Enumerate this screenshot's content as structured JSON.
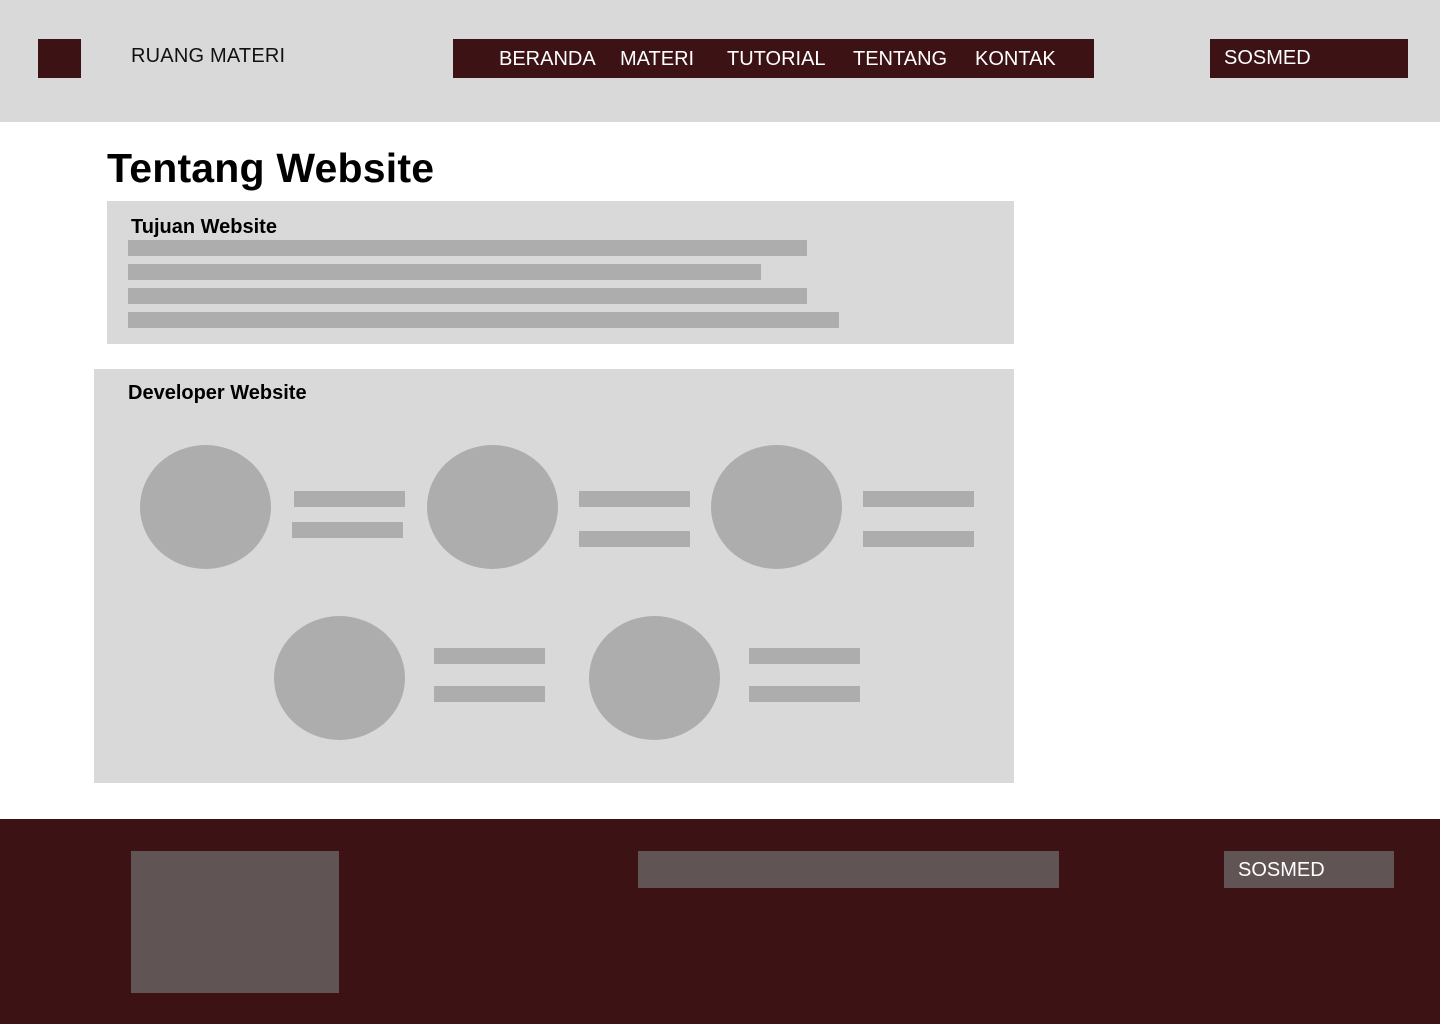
{
  "header": {
    "site_name": "RUANG MATERI",
    "nav": [
      "BERANDA",
      "MATERI",
      "TUTORIAL",
      "TENTANG",
      "KONTAK"
    ],
    "sosmed_label": "SOSMED"
  },
  "main": {
    "title": "Tentang Website",
    "tujuan_title": "Tujuan Website",
    "developer_title": "Developer Website"
  },
  "footer": {
    "sosmed_label": "SOSMED"
  },
  "colors": {
    "primary": "#3d1214",
    "header_bg": "#d9d9d9",
    "placeholder": "#adadad",
    "footer_block": "#615454"
  }
}
